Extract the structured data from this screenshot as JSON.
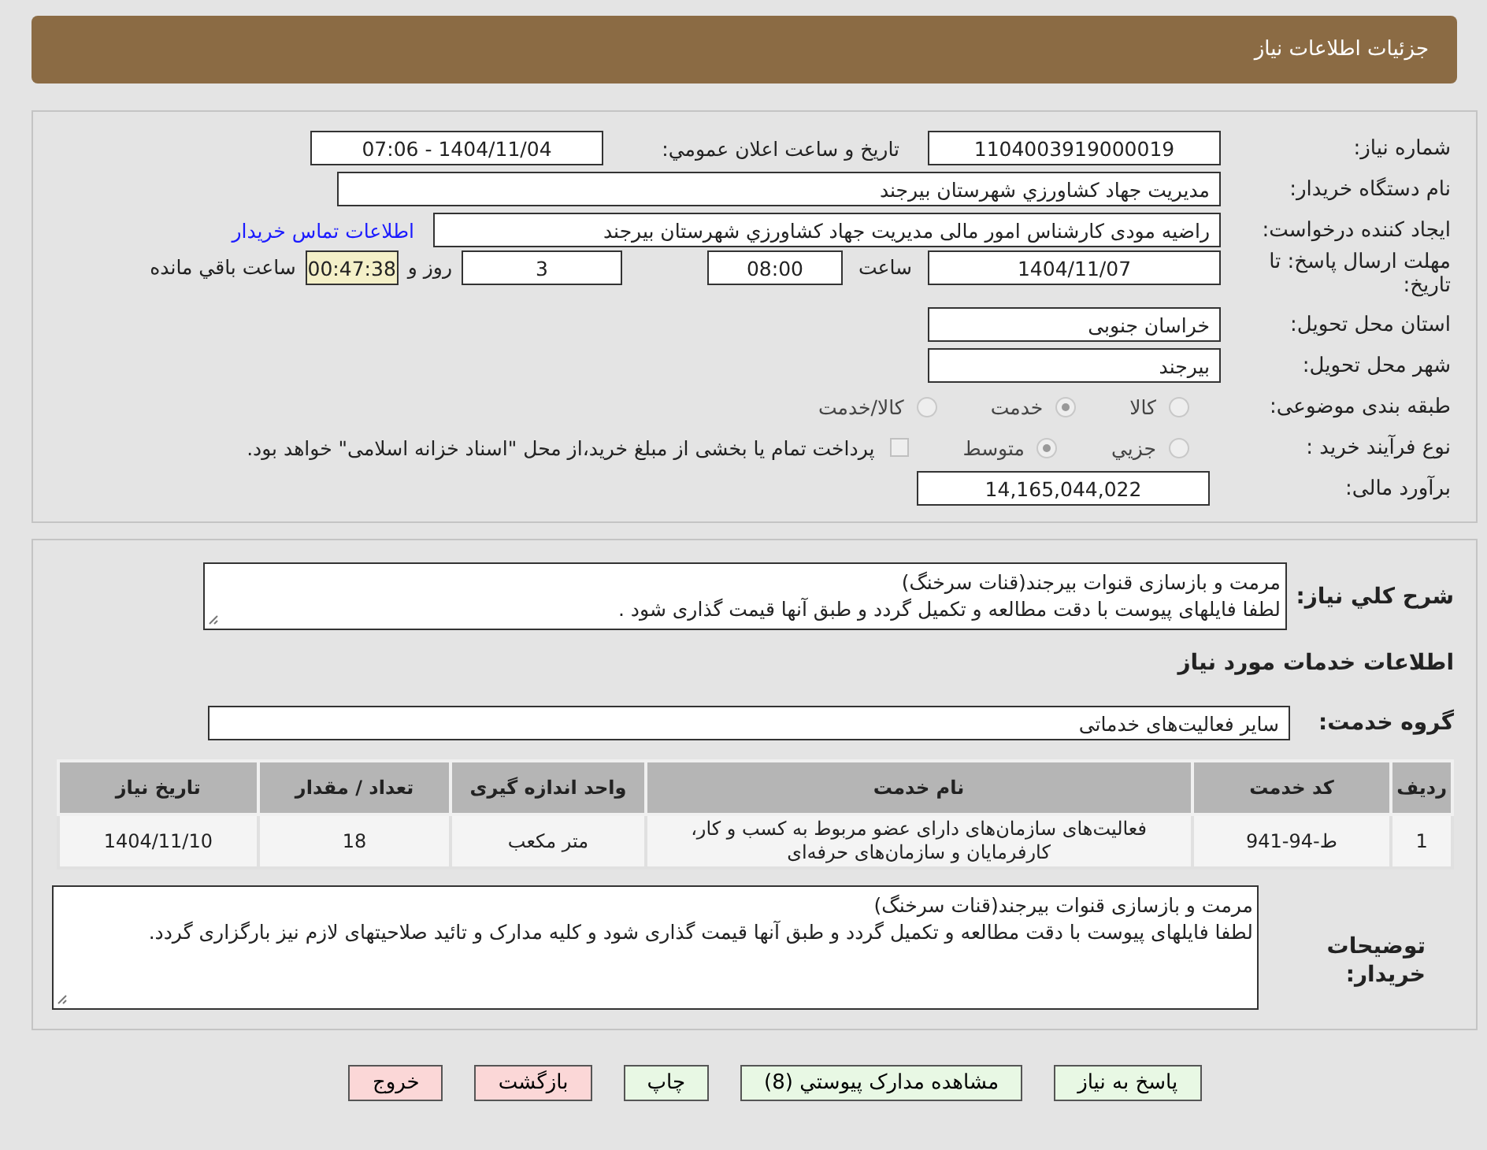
{
  "header": {
    "title": "جزئیات اطلاعات نیاز"
  },
  "details": {
    "need_number": {
      "label": "شماره نياز:",
      "value": "1104003919000019"
    },
    "announce": {
      "label": "تاريخ و ساعت اعلان عمومي:",
      "value": "1404/11/04 - 07:06"
    },
    "buyer": {
      "label": "نام دستگاه خريدار:",
      "value": "مديريت جهاد كشاورزي شهرستان بيرجند"
    },
    "requester": {
      "label": "ايجاد کننده درخواست:",
      "value": "راضيه مودی كارشناس امور مالی مديريت جهاد كشاورزي شهرستان بيرجند",
      "link": "اطلاعات تماس خريدار"
    },
    "deadline": {
      "label": "مهلت ارسال پاسخ: تا تاريخ:",
      "date": "1404/11/07",
      "time_label": "ساعت",
      "time": "08:00",
      "days": "3",
      "days_label": "روز و",
      "remaining": "00:47:38",
      "remaining_label": "ساعت باقي مانده"
    },
    "province": {
      "label": "استان محل تحويل:",
      "value": "خراسان جنوبی"
    },
    "city": {
      "label": "شهر محل تحويل:",
      "value": "بيرجند"
    },
    "category": {
      "label": "طبقه بندی موضوعی:",
      "options": [
        {
          "label": "كالا",
          "selected": false
        },
        {
          "label": "خدمت",
          "selected": true
        },
        {
          "label": "كالا/خدمت",
          "selected": false
        }
      ]
    },
    "process": {
      "label": "نوع فرآيند خريد :",
      "options": [
        {
          "label": "جزيي",
          "selected": false
        },
        {
          "label": "متوسط",
          "selected": true
        }
      ],
      "payment": {
        "checked": false,
        "label": "پرداخت تمام يا بخشی از مبلغ خريد،از محل \"اسناد خزانه اسلامی\" خواهد بود."
      }
    },
    "estimate": {
      "label": "برآورد مالی:",
      "value": "14,165,044,022"
    }
  },
  "summary": {
    "label": "شرح كلي نياز:",
    "text": "مرمت و بازسازی قنوات بیرجند(قنات سرخنگ)\nلطفا فایلهای پیوست با دقت مطالعه و تکمیل گردد و طبق آنها قیمت گذاری شود ."
  },
  "services_title": "اطلاعات خدمات مورد نياز",
  "service_group": {
    "label": "گروه خدمت:",
    "value": "سایر فعالیت‌های خدماتی"
  },
  "table": {
    "columns": [
      "رديف",
      "كد خدمت",
      "نام خدمت",
      "واحد اندازه گيری",
      "تعداد / مقدار",
      "تاريخ نياز"
    ],
    "rows": [
      [
        "1",
        "ط-94-941",
        "فعالیت‌های سازمان‌های دارای عضو مربوط به کسب و کار، کارفرمایان و سازمان‌های حرفه‌ای",
        "متر مکعب",
        "18",
        "1404/11/10"
      ]
    ]
  },
  "buyer_notes": {
    "label": "توضيحات خريدار:",
    "text": "مرمت و بازسازی قنوات بیرجند(قنات سرخنگ)\nلطفا فایلهای پیوست با دقت مطالعه و تکمیل گردد و طبق آنها قیمت گذاری شود و کلیه مدارک و تائید صلاحیتهای لازم نیز بارگزاری گردد."
  },
  "buttons": [
    {
      "label": "پاسخ به نياز",
      "kind": "normal"
    },
    {
      "label": "مشاهده مدارک پيوستي (8)",
      "kind": "normal"
    },
    {
      "label": "چاپ",
      "kind": "normal"
    },
    {
      "label": "بازگشت",
      "kind": "danger"
    },
    {
      "label": "خروج",
      "kind": "danger"
    }
  ]
}
